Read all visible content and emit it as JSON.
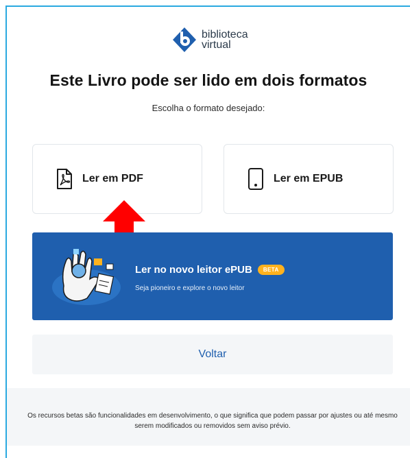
{
  "logo": {
    "line1": "biblioteca",
    "line2": "virtual"
  },
  "heading": "Este Livro pode ser lido em dois formatos",
  "subheading": "Escolha o formato desejado:",
  "options": {
    "pdf": {
      "label": "Ler em PDF",
      "icon": "pdf-file-icon"
    },
    "epub": {
      "label": "Ler em EPUB",
      "icon": "tablet-icon"
    }
  },
  "banner": {
    "title": "Ler no novo leitor ePUB",
    "badge": "BETA",
    "subtitle": "Seja pioneiro e explore o novo leitor",
    "illustration": "hand-waving-illustration"
  },
  "back_button": "Voltar",
  "footer_note": "Os recursos betas são funcionalidades em desenvolvimento, o que significa que podem passar por ajustes ou até mesmo serem modificados ou removidos sem aviso prévio.",
  "colors": {
    "primary_blue": "#1f5fae",
    "frame_border": "#29a9e0",
    "beta_orange": "#ffb21e",
    "annotation_arrow": "#ff0000"
  }
}
